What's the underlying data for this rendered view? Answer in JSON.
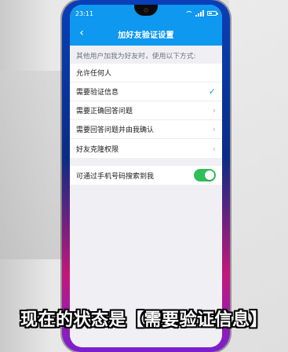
{
  "status_bar": {
    "time": "23:11",
    "battery_level": 0.5
  },
  "header": {
    "title": "加好友验证设置"
  },
  "section": {
    "label": "其他用户加我为好友时，使用以下方式:"
  },
  "options": [
    {
      "label": "允许任何人",
      "accessory": ""
    },
    {
      "label": "需要验证信息",
      "accessory": "✓"
    },
    {
      "label": "需要正确回答问题",
      "accessory": "›"
    },
    {
      "label": "需要回答问题并由我确认",
      "accessory": "›"
    },
    {
      "label": "好友克隆权限",
      "accessory": "›"
    }
  ],
  "phone_search": {
    "label": "可通过手机号码搜索到我",
    "enabled": true
  },
  "caption": {
    "text": "现在的状态是【需要验证信息】"
  },
  "colors": {
    "brand_blue": "#0e98f0",
    "toggle_on": "#2fbf59"
  },
  "icons": {
    "back": "back-arrow-icon",
    "check": "checkmark-icon",
    "chevron": "chevron-right-icon",
    "wifi": "wifi-icon",
    "signal": "signal-icon",
    "battery": "battery-icon"
  }
}
